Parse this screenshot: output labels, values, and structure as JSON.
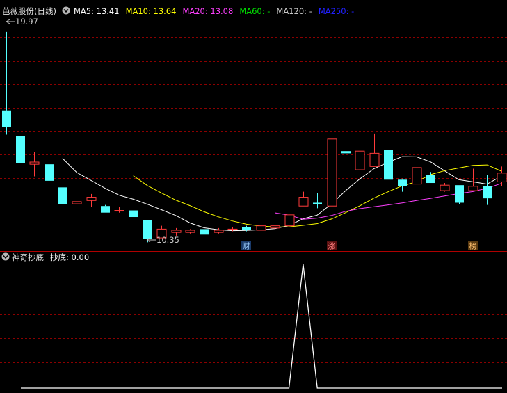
{
  "title": "芭薇股份(日线)",
  "ma_legend": [
    {
      "label": "MA5: 13.41",
      "color": "#ffffff"
    },
    {
      "label": "MA10: 13.64",
      "color": "#ffff00"
    },
    {
      "label": "MA20: 13.08",
      "color": "#ff40ff"
    },
    {
      "label": "MA60: -",
      "color": "#00e000"
    },
    {
      "label": "MA120: -",
      "color": "#c8c8c8"
    },
    {
      "label": "MA250: -",
      "color": "#2020ff"
    }
  ],
  "colors": {
    "up": "#ff3b3b",
    "down": "#54ffff",
    "grid": "#8b0000",
    "ma5": "#ffffff",
    "ma10": "#ffff00",
    "ma20": "#ff40ff",
    "indicator": "#ffffff"
  },
  "high_label": "19.97",
  "low_label": "10.35",
  "event_markers": [
    {
      "text": "财",
      "index": 17
    },
    {
      "text": "涨",
      "index": 23
    },
    {
      "text": "榜",
      "index": 33
    }
  ],
  "indicator_title": "神奇抄底",
  "indicator_label": "抄底: 0.00",
  "chart_data": [
    {
      "type": "candlestick",
      "title": "芭薇股份(日线)",
      "ylim": [
        10.0,
        20.6
      ],
      "candles": [
        {
          "o": 16.4,
          "c": 15.65,
          "h": 19.97,
          "l": 15.3
        },
        {
          "o": 15.25,
          "c": 14.0,
          "h": 15.25,
          "l": 14.0
        },
        {
          "o": 13.95,
          "c": 14.05,
          "h": 14.5,
          "l": 13.4
        },
        {
          "o": 13.95,
          "c": 13.2,
          "h": 13.95,
          "l": 13.2
        },
        {
          "o": 12.9,
          "c": 12.15,
          "h": 12.95,
          "l": 12.15
        },
        {
          "o": 12.15,
          "c": 12.25,
          "h": 12.5,
          "l": 12.15
        },
        {
          "o": 12.3,
          "c": 12.45,
          "h": 12.6,
          "l": 12.0
        },
        {
          "o": 12.05,
          "c": 11.75,
          "h": 12.1,
          "l": 11.75
        },
        {
          "o": 11.85,
          "c": 11.85,
          "h": 12.0,
          "l": 11.75
        },
        {
          "o": 11.85,
          "c": 11.55,
          "h": 11.95,
          "l": 11.5
        },
        {
          "o": 11.4,
          "c": 10.55,
          "h": 11.4,
          "l": 10.4
        },
        {
          "o": 10.6,
          "c": 11.0,
          "h": 11.15,
          "l": 10.6
        },
        {
          "o": 10.85,
          "c": 10.95,
          "h": 11.05,
          "l": 10.7
        },
        {
          "o": 10.85,
          "c": 10.95,
          "h": 11.0,
          "l": 10.8
        },
        {
          "o": 11.0,
          "c": 10.75,
          "h": 11.0,
          "l": 10.55
        },
        {
          "o": 10.85,
          "c": 10.95,
          "h": 11.05,
          "l": 10.8
        },
        {
          "o": 11.0,
          "c": 11.0,
          "h": 11.1,
          "l": 10.9
        },
        {
          "o": 11.1,
          "c": 10.95,
          "h": 11.15,
          "l": 10.9
        },
        {
          "o": 10.95,
          "c": 11.15,
          "h": 11.2,
          "l": 10.95
        },
        {
          "o": 11.05,
          "c": 11.15,
          "h": 11.25,
          "l": 11.05
        },
        {
          "o": 11.15,
          "c": 11.65,
          "h": 11.65,
          "l": 11.15
        },
        {
          "o": 12.05,
          "c": 12.45,
          "h": 12.7,
          "l": 12.05
        },
        {
          "o": 12.2,
          "c": 12.15,
          "h": 12.65,
          "l": 11.95
        },
        {
          "o": 12.05,
          "c": 15.1,
          "h": 15.1,
          "l": 12.05
        },
        {
          "o": 14.55,
          "c": 14.45,
          "h": 16.2,
          "l": 14.45
        },
        {
          "o": 13.7,
          "c": 14.55,
          "h": 14.65,
          "l": 13.7
        },
        {
          "o": 13.85,
          "c": 14.45,
          "h": 15.35,
          "l": 13.85
        },
        {
          "o": 14.6,
          "c": 13.25,
          "h": 14.6,
          "l": 13.25
        },
        {
          "o": 13.25,
          "c": 12.95,
          "h": 13.3,
          "l": 12.7
        },
        {
          "o": 13.05,
          "c": 13.8,
          "h": 13.8,
          "l": 13.05
        },
        {
          "o": 13.45,
          "c": 13.1,
          "h": 13.6,
          "l": 13.1
        },
        {
          "o": 12.75,
          "c": 13.0,
          "h": 13.1,
          "l": 12.7
        },
        {
          "o": 13.0,
          "c": 12.2,
          "h": 13.0,
          "l": 12.15
        },
        {
          "o": 12.75,
          "c": 12.95,
          "h": 13.75,
          "l": 12.75
        },
        {
          "o": 12.95,
          "c": 12.4,
          "h": 13.45,
          "l": 12.1
        },
        {
          "o": 13.15,
          "c": 13.55,
          "h": 13.85,
          "l": 12.95
        }
      ],
      "ma5": [
        null,
        null,
        null,
        null,
        14.22,
        13.58,
        13.22,
        12.86,
        12.54,
        12.36,
        12.13,
        11.88,
        11.62,
        11.28,
        11.06,
        10.97,
        10.93,
        10.94,
        10.97,
        11.02,
        11.16,
        11.47,
        11.64,
        12.14,
        12.75,
        13.28,
        13.75,
        14.04,
        14.3,
        14.29,
        14.06,
        13.65,
        13.25,
        13.15,
        13.05,
        13.41
      ],
      "ma10": [
        null,
        null,
        null,
        null,
        null,
        null,
        null,
        null,
        null,
        13.43,
        12.98,
        12.64,
        12.32,
        12.07,
        11.79,
        11.56,
        11.37,
        11.22,
        11.14,
        11.1,
        11.1,
        11.17,
        11.25,
        11.46,
        11.75,
        12.06,
        12.41,
        12.7,
        12.97,
        13.15,
        13.48,
        13.66,
        13.78,
        13.9,
        13.92,
        13.64
      ],
      "ma20": [
        null,
        null,
        null,
        null,
        null,
        null,
        null,
        null,
        null,
        null,
        null,
        null,
        null,
        null,
        null,
        null,
        null,
        null,
        null,
        11.74,
        11.64,
        11.45,
        11.5,
        11.62,
        11.81,
        11.93,
        12.02,
        12.1,
        12.19,
        12.3,
        12.4,
        12.51,
        12.62,
        12.71,
        12.86,
        13.08
      ]
    },
    {
      "type": "line",
      "title": "神奇抄底",
      "series": [
        {
          "name": "抄底",
          "values": [
            0,
            0,
            0,
            0,
            0,
            0,
            0,
            0,
            0,
            0,
            0,
            0,
            0,
            0,
            0,
            0,
            0,
            0,
            0,
            0,
            0,
            1,
            0,
            0,
            0,
            0,
            0,
            0,
            0,
            0,
            0,
            0,
            0,
            0,
            0,
            0
          ]
        }
      ]
    }
  ]
}
